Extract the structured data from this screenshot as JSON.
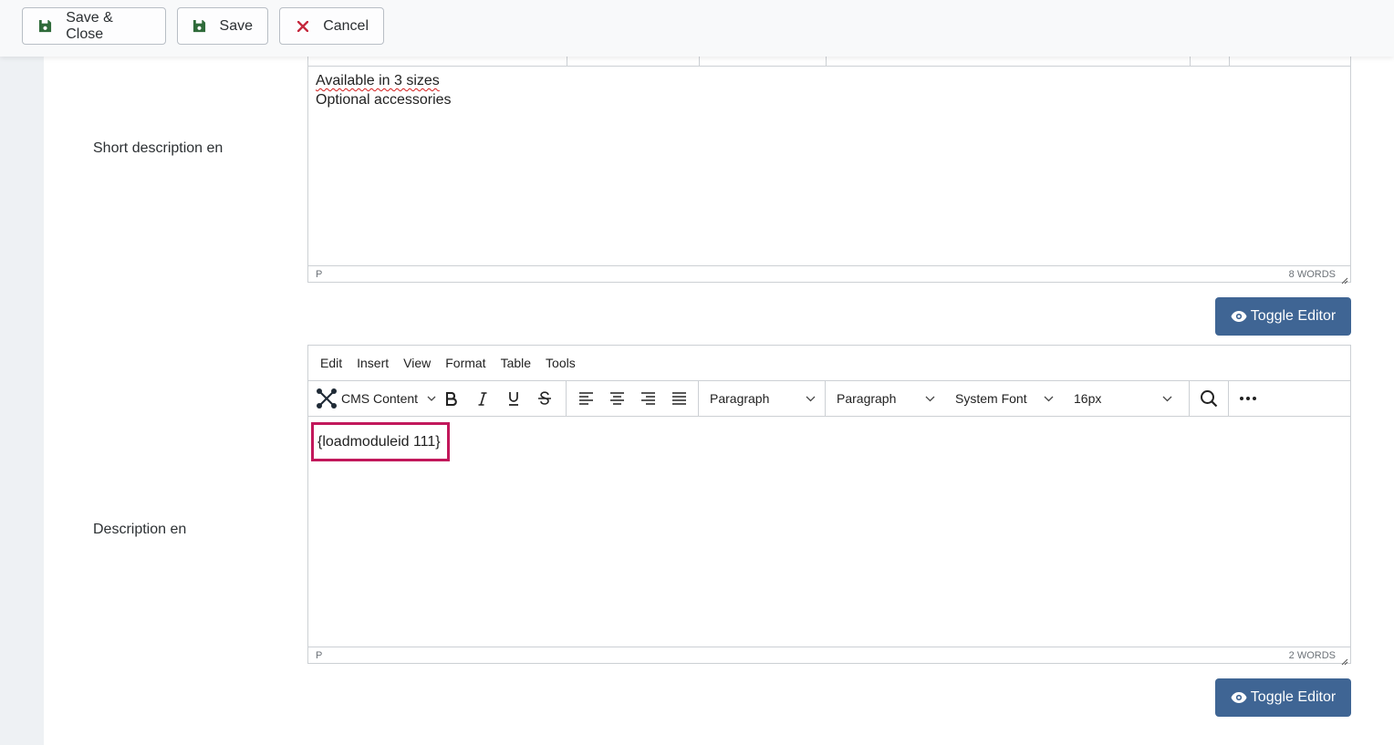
{
  "toolbar": {
    "save_close_label": "Save & Close",
    "save_label": "Save",
    "cancel_label": "Cancel"
  },
  "short_description": {
    "label": "Short description en",
    "lines": [
      "Available in 3 sizes",
      "Optional accessories"
    ],
    "status_path": "P",
    "word_count": "8 WORDS",
    "toggle_label": "Toggle Editor"
  },
  "description": {
    "label": "Description en",
    "menu": [
      "Edit",
      "Insert",
      "View",
      "Format",
      "Table",
      "Tools"
    ],
    "cms_content_label": "CMS Content",
    "block_format": "Paragraph",
    "style_format": "Paragraph",
    "font_family": "System Font",
    "font_size": "16px",
    "content": "{loadmoduleid 111}",
    "status_path": "P",
    "word_count": "2 WORDS",
    "toggle_label": "Toggle Editor"
  },
  "colors": {
    "toggle_button": "#3f6594",
    "save_icon": "#2f6b3a",
    "cancel_icon": "#c5283d",
    "highlight_box": "#c2185b"
  }
}
